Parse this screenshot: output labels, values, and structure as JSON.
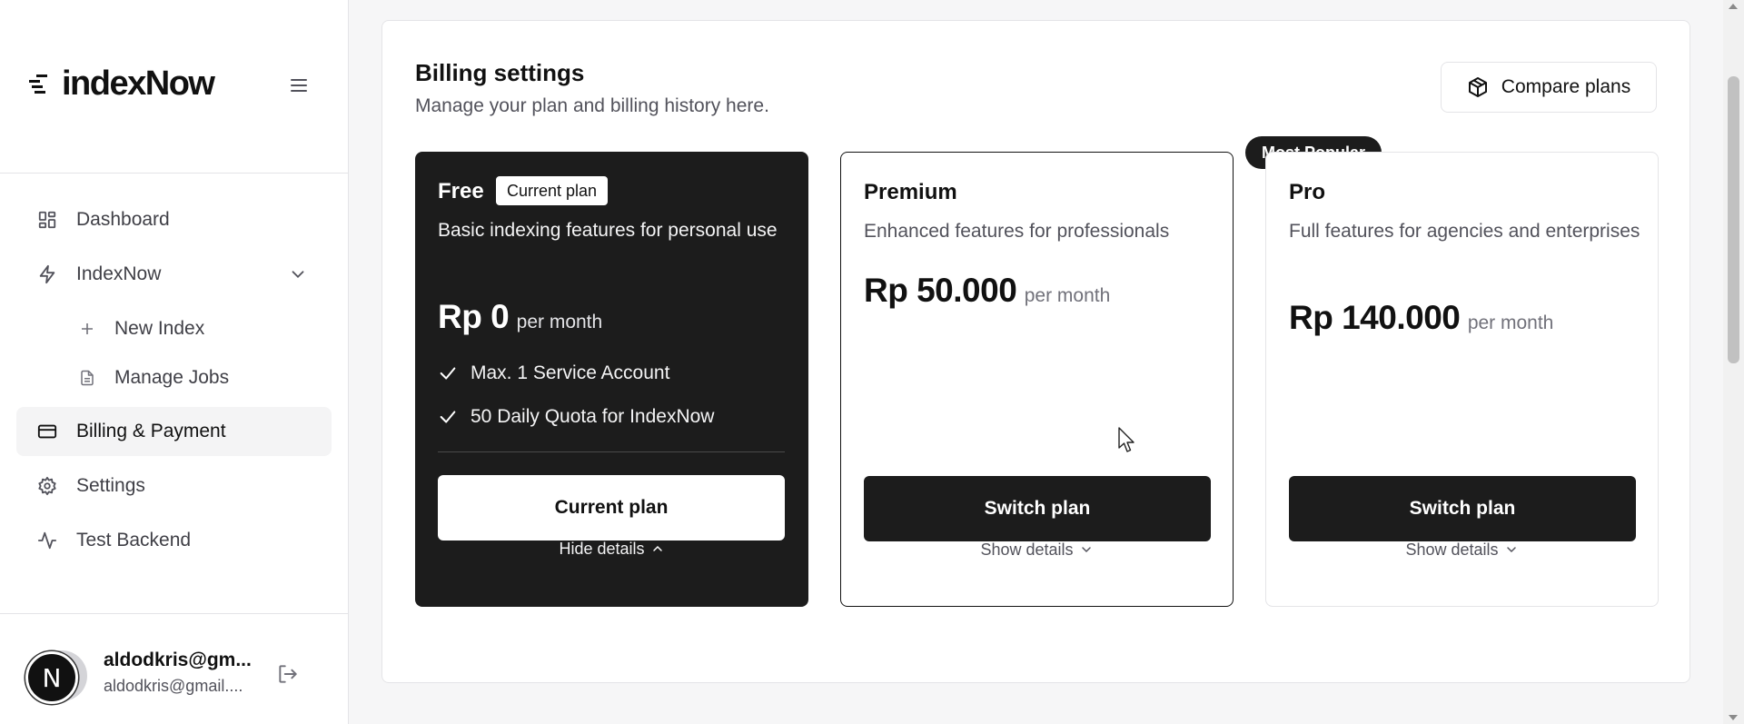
{
  "brand": {
    "name": "indexNow"
  },
  "sidebar": {
    "items": [
      {
        "label": "Dashboard",
        "icon": "dashboard-icon"
      },
      {
        "label": "IndexNow",
        "icon": "zap-icon"
      },
      {
        "label": "New Index",
        "icon": "plus-icon"
      },
      {
        "label": "Manage Jobs",
        "icon": "file-text-icon"
      },
      {
        "label": "Billing & Payment",
        "icon": "credit-card-icon"
      },
      {
        "label": "Settings",
        "icon": "gear-icon"
      },
      {
        "label": "Test Backend",
        "icon": "activity-icon"
      }
    ],
    "active_item": "Billing & Payment"
  },
  "user": {
    "avatar_initial": "N",
    "name": "aldodkris@gm...",
    "email": "aldodkris@gmail...."
  },
  "header": {
    "title": "Billing settings",
    "subtitle": "Manage your plan and billing history here.",
    "compare_label": "Compare plans"
  },
  "plans": [
    {
      "name": "Free",
      "badge": "Current plan",
      "description": "Basic indexing features for personal use",
      "price": "Rp 0",
      "period": "per month",
      "features": [
        "Max. 1 Service Account",
        "50 Daily Quota for IndexNow"
      ],
      "button": "Current plan",
      "details_toggle": "Hide details"
    },
    {
      "name": "Premium",
      "ribbon": "Most Popular",
      "description": "Enhanced features for professionals",
      "price": "Rp 50.000",
      "period": "per month",
      "button": "Switch plan",
      "details_toggle": "Show details"
    },
    {
      "name": "Pro",
      "description": "Full features for agencies and enterprises",
      "price": "Rp 140.000",
      "period": "per month",
      "button": "Switch plan",
      "details_toggle": "Show details"
    }
  ],
  "colors": {
    "dark": "#1c1c1c",
    "accent_bg": "#f4f4f5",
    "muted_text": "#52525b",
    "border": "#e4e4e7"
  }
}
